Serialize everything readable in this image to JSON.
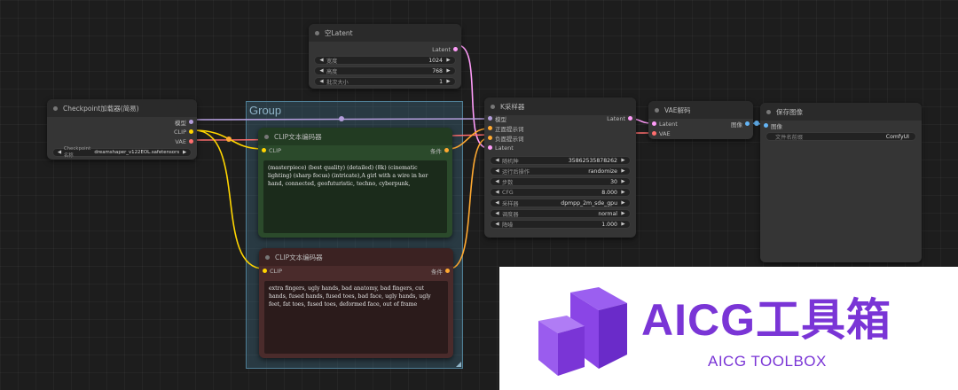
{
  "group": {
    "title": "Group"
  },
  "empty_latent": {
    "title": "空Latent",
    "output": "Latent",
    "widgets": [
      {
        "label": "宽度",
        "value": "1024"
      },
      {
        "label": "高度",
        "value": "768"
      },
      {
        "label": "批次大小",
        "value": "1"
      }
    ]
  },
  "checkpoint": {
    "title": "Checkpoint加载器(简易)",
    "outputs": [
      "模型",
      "CLIP",
      "VAE"
    ],
    "widget": {
      "label": "Checkpoint名称",
      "value": "dreamshaper_v122EOL.safetensors"
    }
  },
  "clip_positive": {
    "title": "CLIP文本编码器",
    "input": "CLIP",
    "output": "条件",
    "text": "(masterpiece) (best quality) (detailed) (8k) (cinematic lighting) (sharp focus) (intricate),A girl with a wire in her hand, connected, geofuturistic, techno, cyberpunk,"
  },
  "clip_negative": {
    "title": "CLIP文本编码器",
    "input": "CLIP",
    "output": "条件",
    "text": "extra fingers, ugly hands, bad anatomy, bad fingers, cut hands, fused hands, fused toes, bad face, ugly hands, ugly feet, fat toes, fused toes, deformed face, out of frame"
  },
  "ksampler": {
    "title": "K采样器",
    "inputs": [
      "模型",
      "正面提示词",
      "负面提示词",
      "Latent"
    ],
    "output": "Latent",
    "widgets": [
      {
        "label": "随机种",
        "value": "358625358782​62"
      },
      {
        "label": "运行后操作",
        "value": "randomize"
      },
      {
        "label": "步数",
        "value": "30"
      },
      {
        "label": "CFG",
        "value": "8.000"
      },
      {
        "label": "采样器",
        "value": "dpmpp_2m_sde_gpu"
      },
      {
        "label": "调度器",
        "value": "normal"
      },
      {
        "label": "降噪",
        "value": "1.000"
      }
    ]
  },
  "vae_decode": {
    "title": "VAE解码",
    "inputs": [
      "Latent",
      "VAE"
    ],
    "output": "图像"
  },
  "save_image": {
    "title": "保存图像",
    "input": "图像",
    "widget": {
      "label": "文件名前缀",
      "value": "ComfyUI"
    }
  },
  "watermark": {
    "title": "AICG工具箱",
    "subtitle": "AICG TOOLBOX",
    "brand_color": "#7a35d6"
  },
  "colors": {
    "latent": "#ff9cf9",
    "model": "#b39ddb",
    "clip": "#ffd500",
    "vae": "#ff6e6e",
    "conditioning": "#ffa931",
    "image": "#64b5f6"
  }
}
